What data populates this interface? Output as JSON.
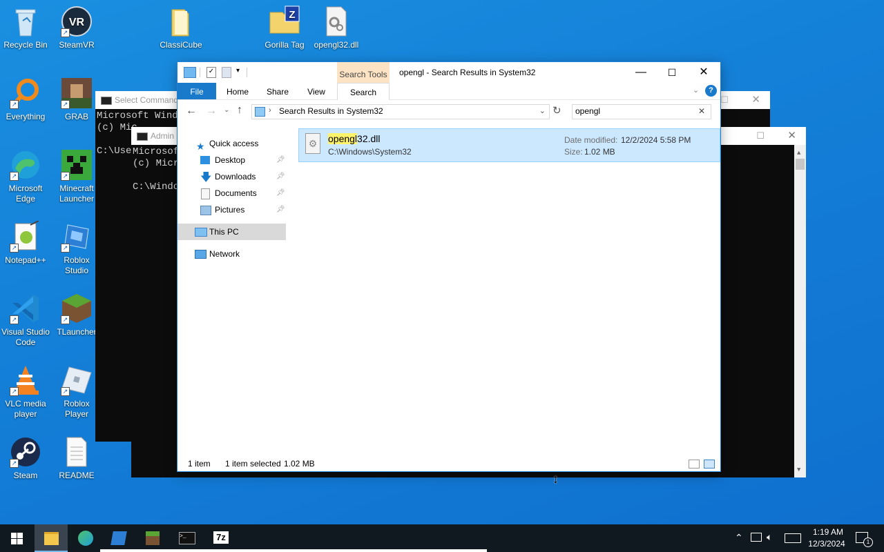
{
  "desktop_icons": [
    {
      "label": "Recycle Bin"
    },
    {
      "label": "SteamVR"
    },
    {
      "label": "ClassiCube"
    },
    {
      "label": "Gorilla Tag"
    },
    {
      "label": "opengl32.dll"
    },
    {
      "label": "Everything"
    },
    {
      "label": "GRAB"
    },
    {
      "label": "Microsoft Edge"
    },
    {
      "label": "Minecraft Launcher"
    },
    {
      "label": "Notepad++"
    },
    {
      "label": "Roblox Studio"
    },
    {
      "label": "Visual Studio Code"
    },
    {
      "label": "TLauncher"
    },
    {
      "label": "VLC media player"
    },
    {
      "label": "Roblox Player"
    },
    {
      "label": "Steam"
    },
    {
      "label": "README"
    }
  ],
  "cmd_back": {
    "title": "Select Command",
    "lines": "Microsoft Windo\n(c) Mic\n\nC:\\Use"
  },
  "cmd_front": {
    "title": "Admin",
    "lines": "Microsoft\n(c) Micr\n\nC:\\Windo"
  },
  "explorer": {
    "context_tab": "Search Tools",
    "title": "opengl - Search Results in System32",
    "tabs": {
      "file": "File",
      "home": "Home",
      "share": "Share",
      "view": "View",
      "search": "Search"
    },
    "address": "Search Results in System32",
    "search_value": "opengl",
    "nav": {
      "quick_access": "Quick access",
      "desktop": "Desktop",
      "downloads": "Downloads",
      "documents": "Documents",
      "pictures": "Pictures",
      "this_pc": "This PC",
      "network": "Network"
    },
    "result": {
      "name_highlight": "opengl",
      "name_rest": "32.dll",
      "path": "C:\\Windows\\System32",
      "date_label": "Date modified:",
      "date_value": "12/2/2024 5:58 PM",
      "size_label": "Size:",
      "size_value": "1.02 MB"
    },
    "status": {
      "count": "1 item",
      "selected": "1 item selected",
      "size": "1.02 MB"
    }
  },
  "taskbar": {
    "time": "1:19 AM",
    "date": "12/3/2024",
    "notif_count": "1",
    "sevenzip": "7z"
  },
  "colors": {
    "accent": "#1979ca",
    "selection": "#cce8ff",
    "context_tab": "#fbe3c4"
  }
}
